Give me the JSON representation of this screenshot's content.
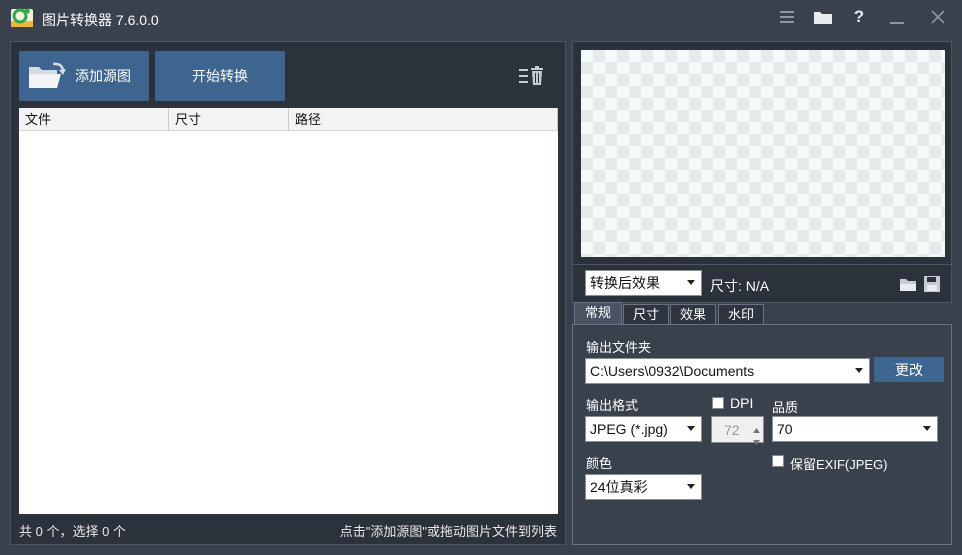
{
  "window": {
    "title": "图片转换器 7.6.0.0"
  },
  "toolbar": {
    "add_label": "添加源图",
    "start_label": "开始转换"
  },
  "file_list": {
    "columns": [
      "文件",
      "尺寸",
      "路径"
    ],
    "rows": []
  },
  "status": {
    "count_text": "共 0 个，选择 0 个",
    "hint_text": "点击\"添加源图\"或拖动图片文件到列表"
  },
  "preview": {
    "view_mode": "转换后效果",
    "size_text": "尺寸: N/A"
  },
  "tabs": [
    "常规",
    "尺寸",
    "效果",
    "水印"
  ],
  "general": {
    "output_folder_label": "输出文件夹",
    "output_folder_value": "C:\\Users\\0932\\Documents",
    "change_label": "更改",
    "format_label": "输出格式",
    "format_value": "JPEG (*.jpg)",
    "dpi_label": "DPI",
    "dpi_value": "72",
    "quality_label": "品质",
    "quality_value": "70",
    "color_label": "颜色",
    "color_value": "24位真彩",
    "exif_label": "保留EXIF(JPEG)"
  },
  "colors": {
    "accent_button": "#3d6590",
    "window_bg": "#39414d",
    "panel_bg": "#2b323c"
  },
  "icons": [
    "app-logo-icon",
    "menu-icon",
    "folder-icon",
    "help-icon",
    "minimize-icon",
    "close-icon",
    "open-folder-icon",
    "clear-list-icon",
    "open-file-icon",
    "save-icon",
    "spin-up-icon",
    "spin-down-icon"
  ]
}
